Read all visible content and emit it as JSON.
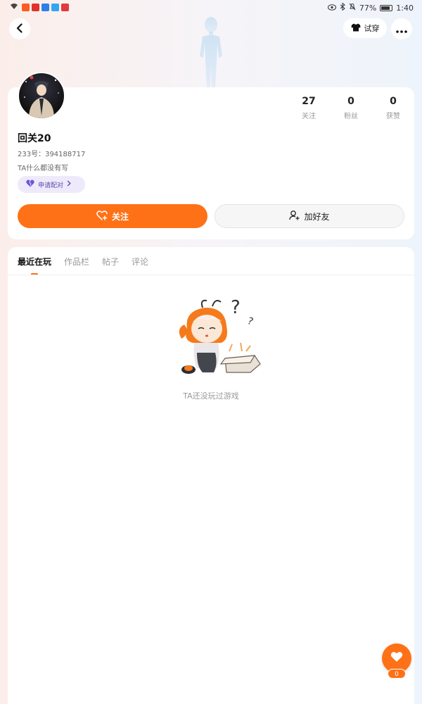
{
  "status_bar": {
    "battery_percent": "77%",
    "time": "1:40",
    "app_icon_colors": [
      "#ff5a1f",
      "#e0332c",
      "#2f7fe8",
      "#35a5f0",
      "#e23a3a"
    ]
  },
  "nav": {
    "back_icon": "chevron-left-icon",
    "tryon_label": "试穿",
    "tryon_icon": "shirt-icon",
    "more_icon": "more-dots-icon"
  },
  "profile": {
    "username": "回关20",
    "user_id": "233号：394188717",
    "bio": "TA什么都没有写",
    "pair_label": "申请配对",
    "stats": [
      {
        "value": "27",
        "label": "关注"
      },
      {
        "value": "0",
        "label": "粉丝"
      },
      {
        "value": "0",
        "label": "获赞"
      }
    ],
    "follow_label": "关注",
    "add_friend_label": "加好友"
  },
  "tabs": [
    {
      "label": "最近在玩",
      "active": true
    },
    {
      "label": "作品栏",
      "active": false
    },
    {
      "label": "帖子",
      "active": false
    },
    {
      "label": "评论",
      "active": false
    }
  ],
  "empty_state": {
    "text": "TA还没玩过游戏"
  },
  "like_fab": {
    "count": "0",
    "icon": "heart-icon"
  },
  "colors": {
    "accent": "#ff7116",
    "pair_bg": "#eeeafb",
    "pair_text": "#5a4aa8"
  }
}
